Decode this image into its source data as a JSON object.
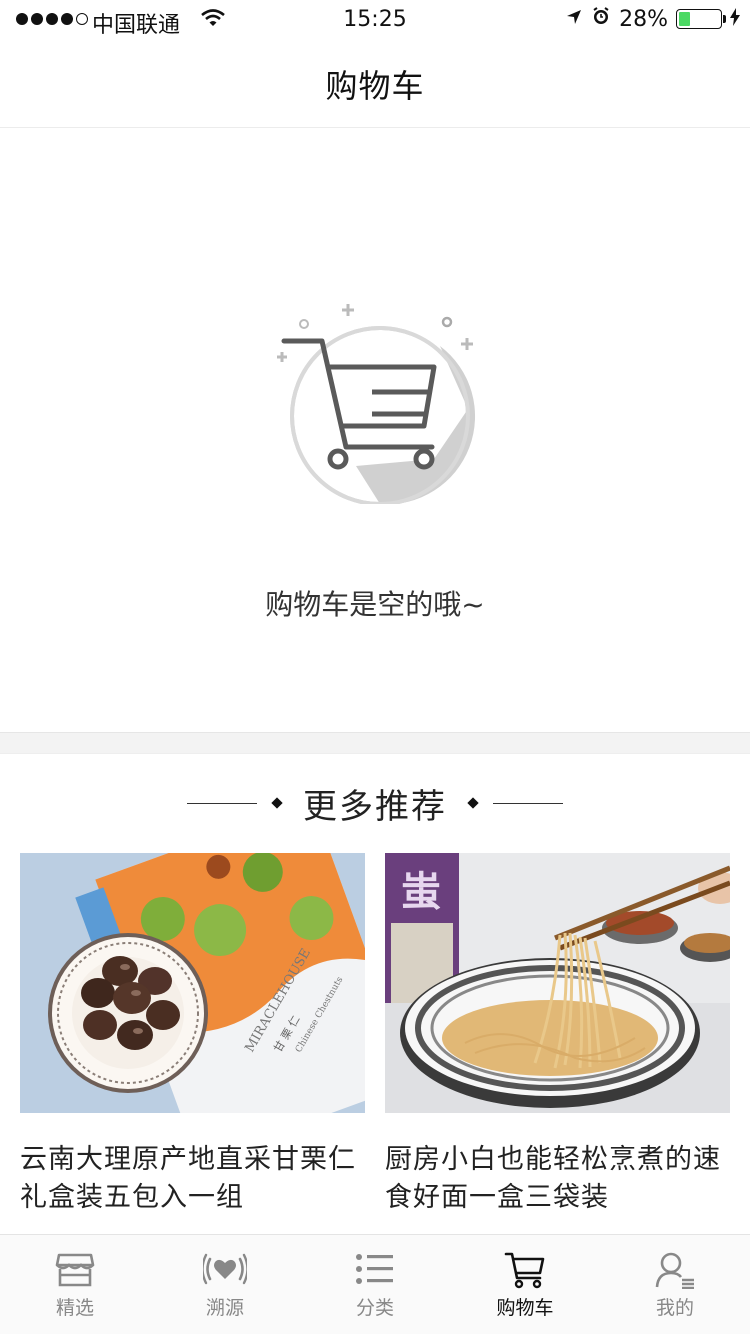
{
  "status_bar": {
    "carrier": "中国联通",
    "time": "15:25",
    "battery": "28%",
    "battery_level": 0.28
  },
  "nav": {
    "title": "购物车"
  },
  "empty_state": {
    "message": "购物车是空的哦~"
  },
  "recommend": {
    "heading": "更多推荐",
    "products": [
      {
        "title": "云南大理原产地直采甘栗仁礼盒装五包入一组",
        "package_brand": "MIRACLEHOUSE",
        "package_name": "甘 栗 仁",
        "package_sub": "Chinese Chestnuts"
      },
      {
        "title": "厨房小白也能轻松烹煮的速食好面一盒三袋装",
        "package_char": "蚩"
      }
    ]
  },
  "tabs": [
    {
      "label": "精选",
      "icon": "shop-icon",
      "active": false
    },
    {
      "label": "溯源",
      "icon": "heart-signal-icon",
      "active": false
    },
    {
      "label": "分类",
      "icon": "list-icon",
      "active": false
    },
    {
      "label": "购物车",
      "icon": "cart-icon",
      "active": true
    },
    {
      "label": "我的",
      "icon": "user-icon",
      "active": false
    }
  ],
  "colors": {
    "battery_fill": "#4cd964",
    "tab_inactive": "#888888",
    "tab_active": "#111111"
  }
}
